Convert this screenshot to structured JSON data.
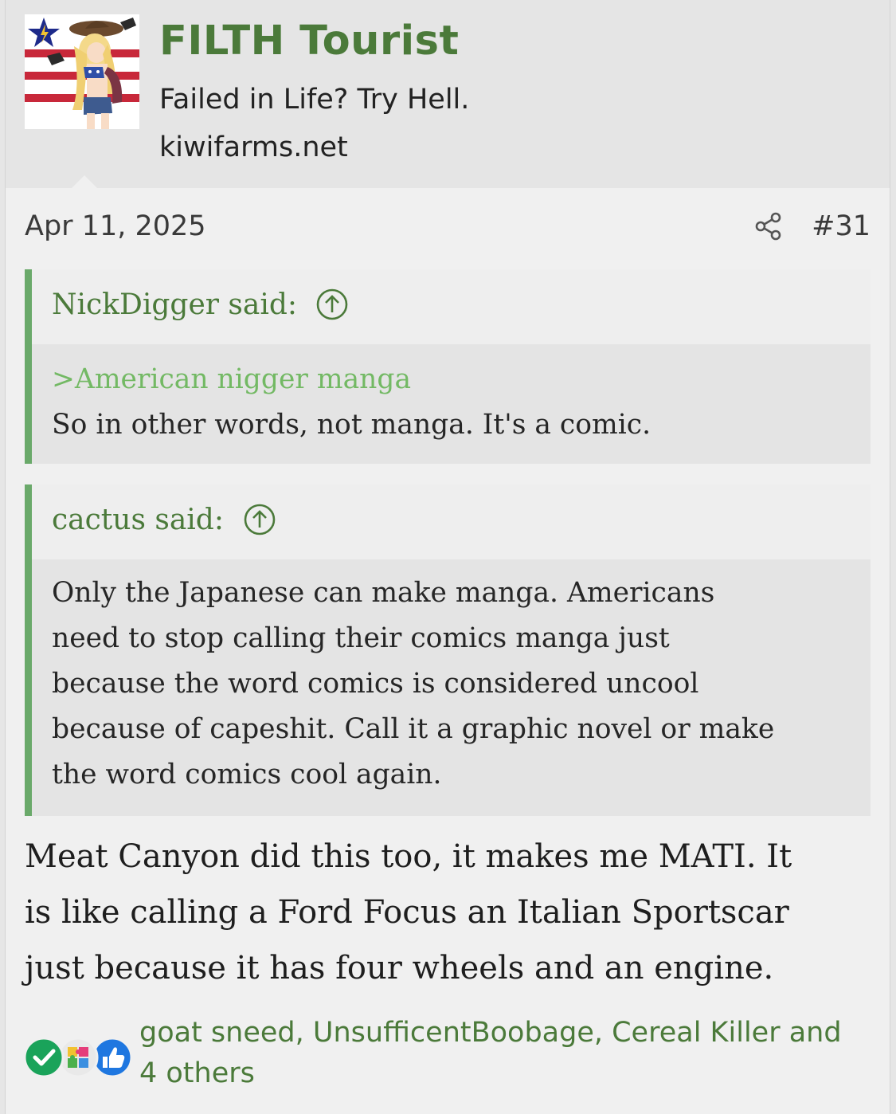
{
  "user": {
    "name": "FILTH Tourist",
    "title": "Failed in Life? Try Hell.",
    "site": "kiwifarms.net"
  },
  "post": {
    "date": "Apr 11, 2025",
    "number": "#31"
  },
  "quotes": [
    {
      "author": "NickDigger said:",
      "greentext": ">American nigger manga",
      "lines": [
        "So in other words, not manga. It's a comic."
      ]
    },
    {
      "author": "cactus said:",
      "lines": [
        "Only the Japanese can make manga. Americans",
        "need to stop calling their comics manga just",
        "because the word comics is considered uncool",
        "because of capeshit. Call it a graphic novel or make",
        "the word comics cool again."
      ]
    }
  ],
  "message": {
    "lines": [
      "Meat Canyon did this too, it makes me MATI. It",
      "is like calling a Ford Focus an Italian Sportscar",
      "just because it has four wheels and an engine."
    ]
  },
  "reactions": {
    "line1": "goat sneed, UnsufficentBoobage, Cereal Killer and",
    "line2": "4 others",
    "icons": [
      "check-reaction",
      "autism-puzzle-reaction",
      "like-reaction"
    ]
  },
  "colors": {
    "username": "#4b7a3a",
    "quote_bar": "#6aa96a",
    "greentext": "#73b964"
  }
}
